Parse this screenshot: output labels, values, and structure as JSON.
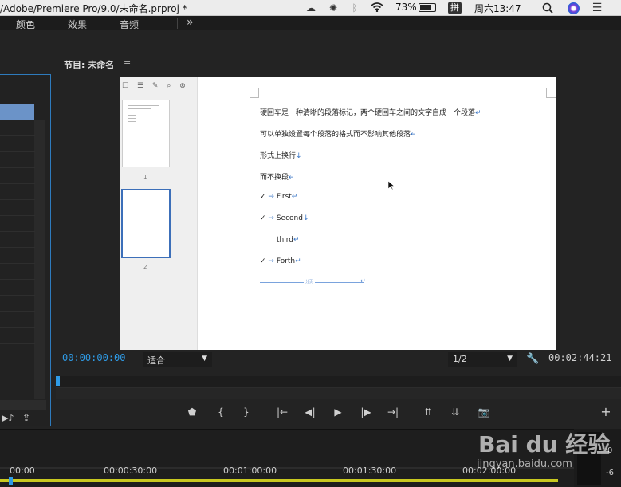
{
  "menubar": {
    "path": "/Adobe/Premiere Pro/9.0/未命名.prproj *",
    "battery": "73%",
    "input_method": "拼",
    "clock": "周六13:47"
  },
  "workspace": {
    "tabs": [
      "颜色",
      "效果",
      "音频"
    ],
    "more": "»"
  },
  "monitor": {
    "panel_title": "节目: 未命名",
    "menu_icon": "≡",
    "timecode_current": "00:00:00:00",
    "fit": "适合",
    "resolution": "1/2",
    "timecode_duration": "00:02:44:21"
  },
  "document": {
    "thumb_pages": [
      "1",
      "2"
    ],
    "lines": [
      "硬回车是一种清晰的段落标记，两个硬回车之间的文字自成一个段落",
      "可以单独设置每个段落的格式而不影响其他段落",
      "形式上换行",
      "而不换段",
      "First",
      "Second",
      "third",
      "Forth"
    ],
    "marks": [
      "↵",
      "↓"
    ],
    "checkmark": "✓",
    "arrow": "→",
    "page_break": "分页"
  },
  "timeline": {
    "ruler": [
      "00:00",
      "00:00:30:00",
      "00:01:00:00",
      "00:01:30:00",
      "00:02:00:00"
    ],
    "meter_labels": [
      "0",
      "-6"
    ]
  },
  "watermark": "Bai du 经验",
  "watermark_url": "jingyan.baidu.com",
  "icons": {
    "add": "+",
    "wrench": "wrench-icon"
  }
}
